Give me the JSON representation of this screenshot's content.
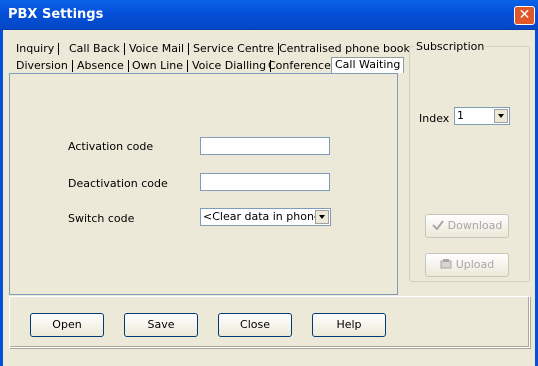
{
  "window": {
    "title": "PBX Settings"
  },
  "tabs": {
    "row1": [
      "Inquiry",
      "Call Back",
      "Voice Mail",
      "Service Centre",
      "Centralised phone book"
    ],
    "row2": [
      "Diversion",
      "Absence",
      "Own Line",
      "Voice Dialling",
      "Conference",
      "Call Waiting"
    ],
    "active": "Call Waiting"
  },
  "form": {
    "activation_label": "Activation code",
    "activation_value": "",
    "deactivation_label": "Deactivation code",
    "deactivation_value": "",
    "switch_label": "Switch code",
    "switch_value": "<Clear data in phone>"
  },
  "subscription": {
    "title": "Subscription",
    "index_label": "Index",
    "index_value": "1",
    "download_label": "Download",
    "upload_label": "Upload"
  },
  "footer": {
    "open_label": "Open",
    "save_label": "Save",
    "close_label": "Close",
    "help_label": "Help"
  }
}
